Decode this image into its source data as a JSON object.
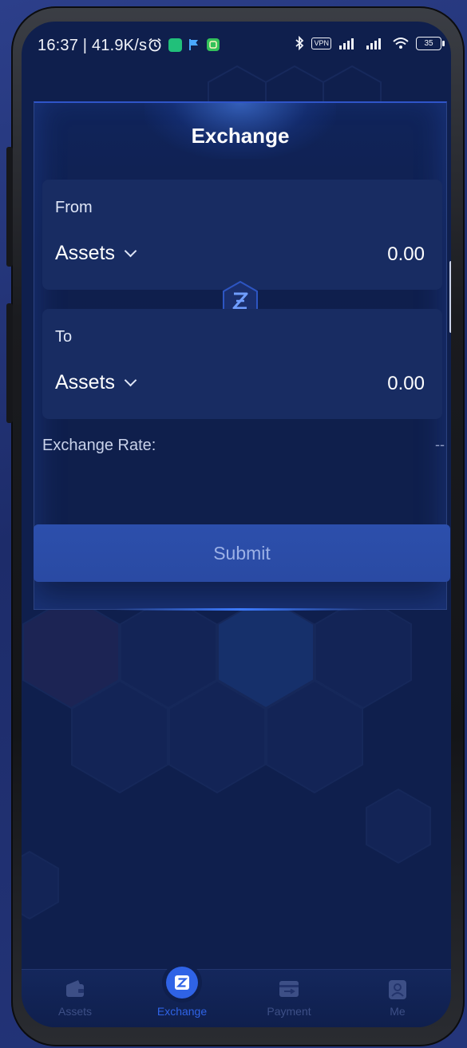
{
  "status_bar": {
    "time_speed": "16:37 | 41.9K/s",
    "vpn": "VPN",
    "battery": "35"
  },
  "exchange": {
    "title": "Exchange",
    "from": {
      "label": "From",
      "asset": "Assets",
      "amount": "0.00"
    },
    "to": {
      "label": "To",
      "asset": "Assets",
      "amount": "0.00"
    },
    "rate_label": "Exchange Rate:",
    "rate_value": "--",
    "submit_label": "Submit"
  },
  "tab_bar": {
    "active": "Exchange",
    "tabs": [
      {
        "label": "Assets",
        "icon": "wallet-icon"
      },
      {
        "label": "Exchange",
        "icon": "exchange-logo-icon"
      },
      {
        "label": "Payment",
        "icon": "payment-icon"
      },
      {
        "label": "Me",
        "icon": "person-icon"
      }
    ]
  },
  "colors": {
    "background": "#0f1f4d",
    "panel": "#182c62",
    "accent": "#2f63e6",
    "submit": "#2c4fac"
  }
}
